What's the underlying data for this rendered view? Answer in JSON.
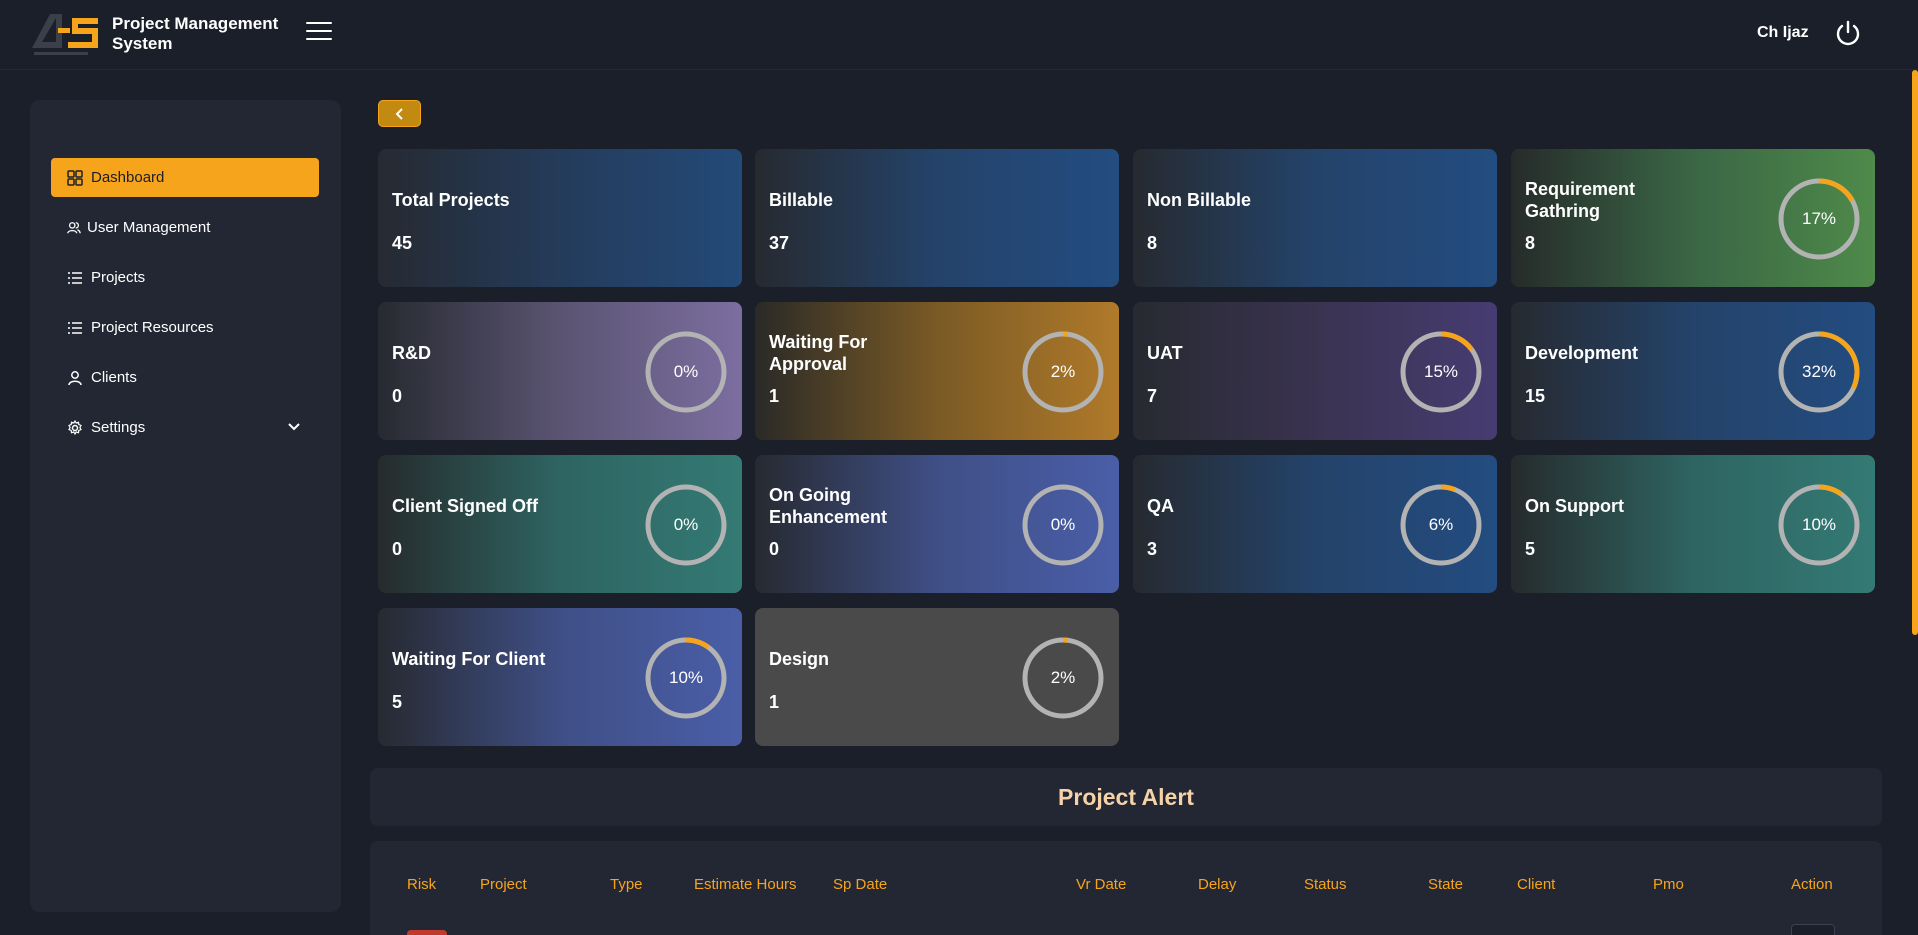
{
  "header": {
    "app_title": "Project Management System",
    "logo_text": "4S",
    "username": "Ch Ijaz"
  },
  "sidebar": {
    "items": [
      {
        "label": "Dashboard",
        "icon": "grid-icon",
        "active": true
      },
      {
        "label": "User Management",
        "icon": "users-icon",
        "active": false
      },
      {
        "label": "Projects",
        "icon": "list-icon",
        "active": false
      },
      {
        "label": "Project Resources",
        "icon": "list-icon",
        "active": false
      },
      {
        "label": "Clients",
        "icon": "user-icon",
        "active": false
      },
      {
        "label": "Settings",
        "icon": "gear-icon",
        "active": false,
        "has_submenu": true
      }
    ]
  },
  "cards": [
    {
      "title": "Total Projects",
      "value": "45"
    },
    {
      "title": "Billable",
      "value": "37"
    },
    {
      "title": "Non Billable",
      "value": "8"
    },
    {
      "title": "Requirement Gathring",
      "value": "8",
      "percent": 17
    },
    {
      "title": "R&D",
      "value": "0",
      "percent": 0
    },
    {
      "title": "Waiting For Approval",
      "value": "1",
      "percent": 2
    },
    {
      "title": "UAT",
      "value": "7",
      "percent": 15
    },
    {
      "title": "Development",
      "value": "15",
      "percent": 32
    },
    {
      "title": "Client Signed Off",
      "value": "0",
      "percent": 0
    },
    {
      "title": "On Going Enhancement",
      "value": "0",
      "percent": 0
    },
    {
      "title": "QA",
      "value": "3",
      "percent": 6
    },
    {
      "title": "On Support",
      "value": "5",
      "percent": 10
    },
    {
      "title": "Waiting For Client",
      "value": "5",
      "percent": 10
    },
    {
      "title": "Design",
      "value": "1",
      "percent": 2
    }
  ],
  "percent_labels": [
    "17%",
    "0%",
    "2%",
    "15%",
    "32%",
    "0%",
    "0%",
    "6%",
    "10%",
    "10%",
    "2%"
  ],
  "alert": {
    "title": "Project Alert",
    "columns": [
      "Risk",
      "Project",
      "Type",
      "Estimate Hours",
      "Sp Date",
      "Vr Date",
      "Delay",
      "Status",
      "State",
      "Client",
      "Pmo",
      "Action"
    ]
  },
  "colors": {
    "accent": "#f7a41d",
    "background": "#1a1f29",
    "panel": "#222733",
    "ring_track": "#b3b3b3",
    "risk_high": "#c0392b"
  }
}
